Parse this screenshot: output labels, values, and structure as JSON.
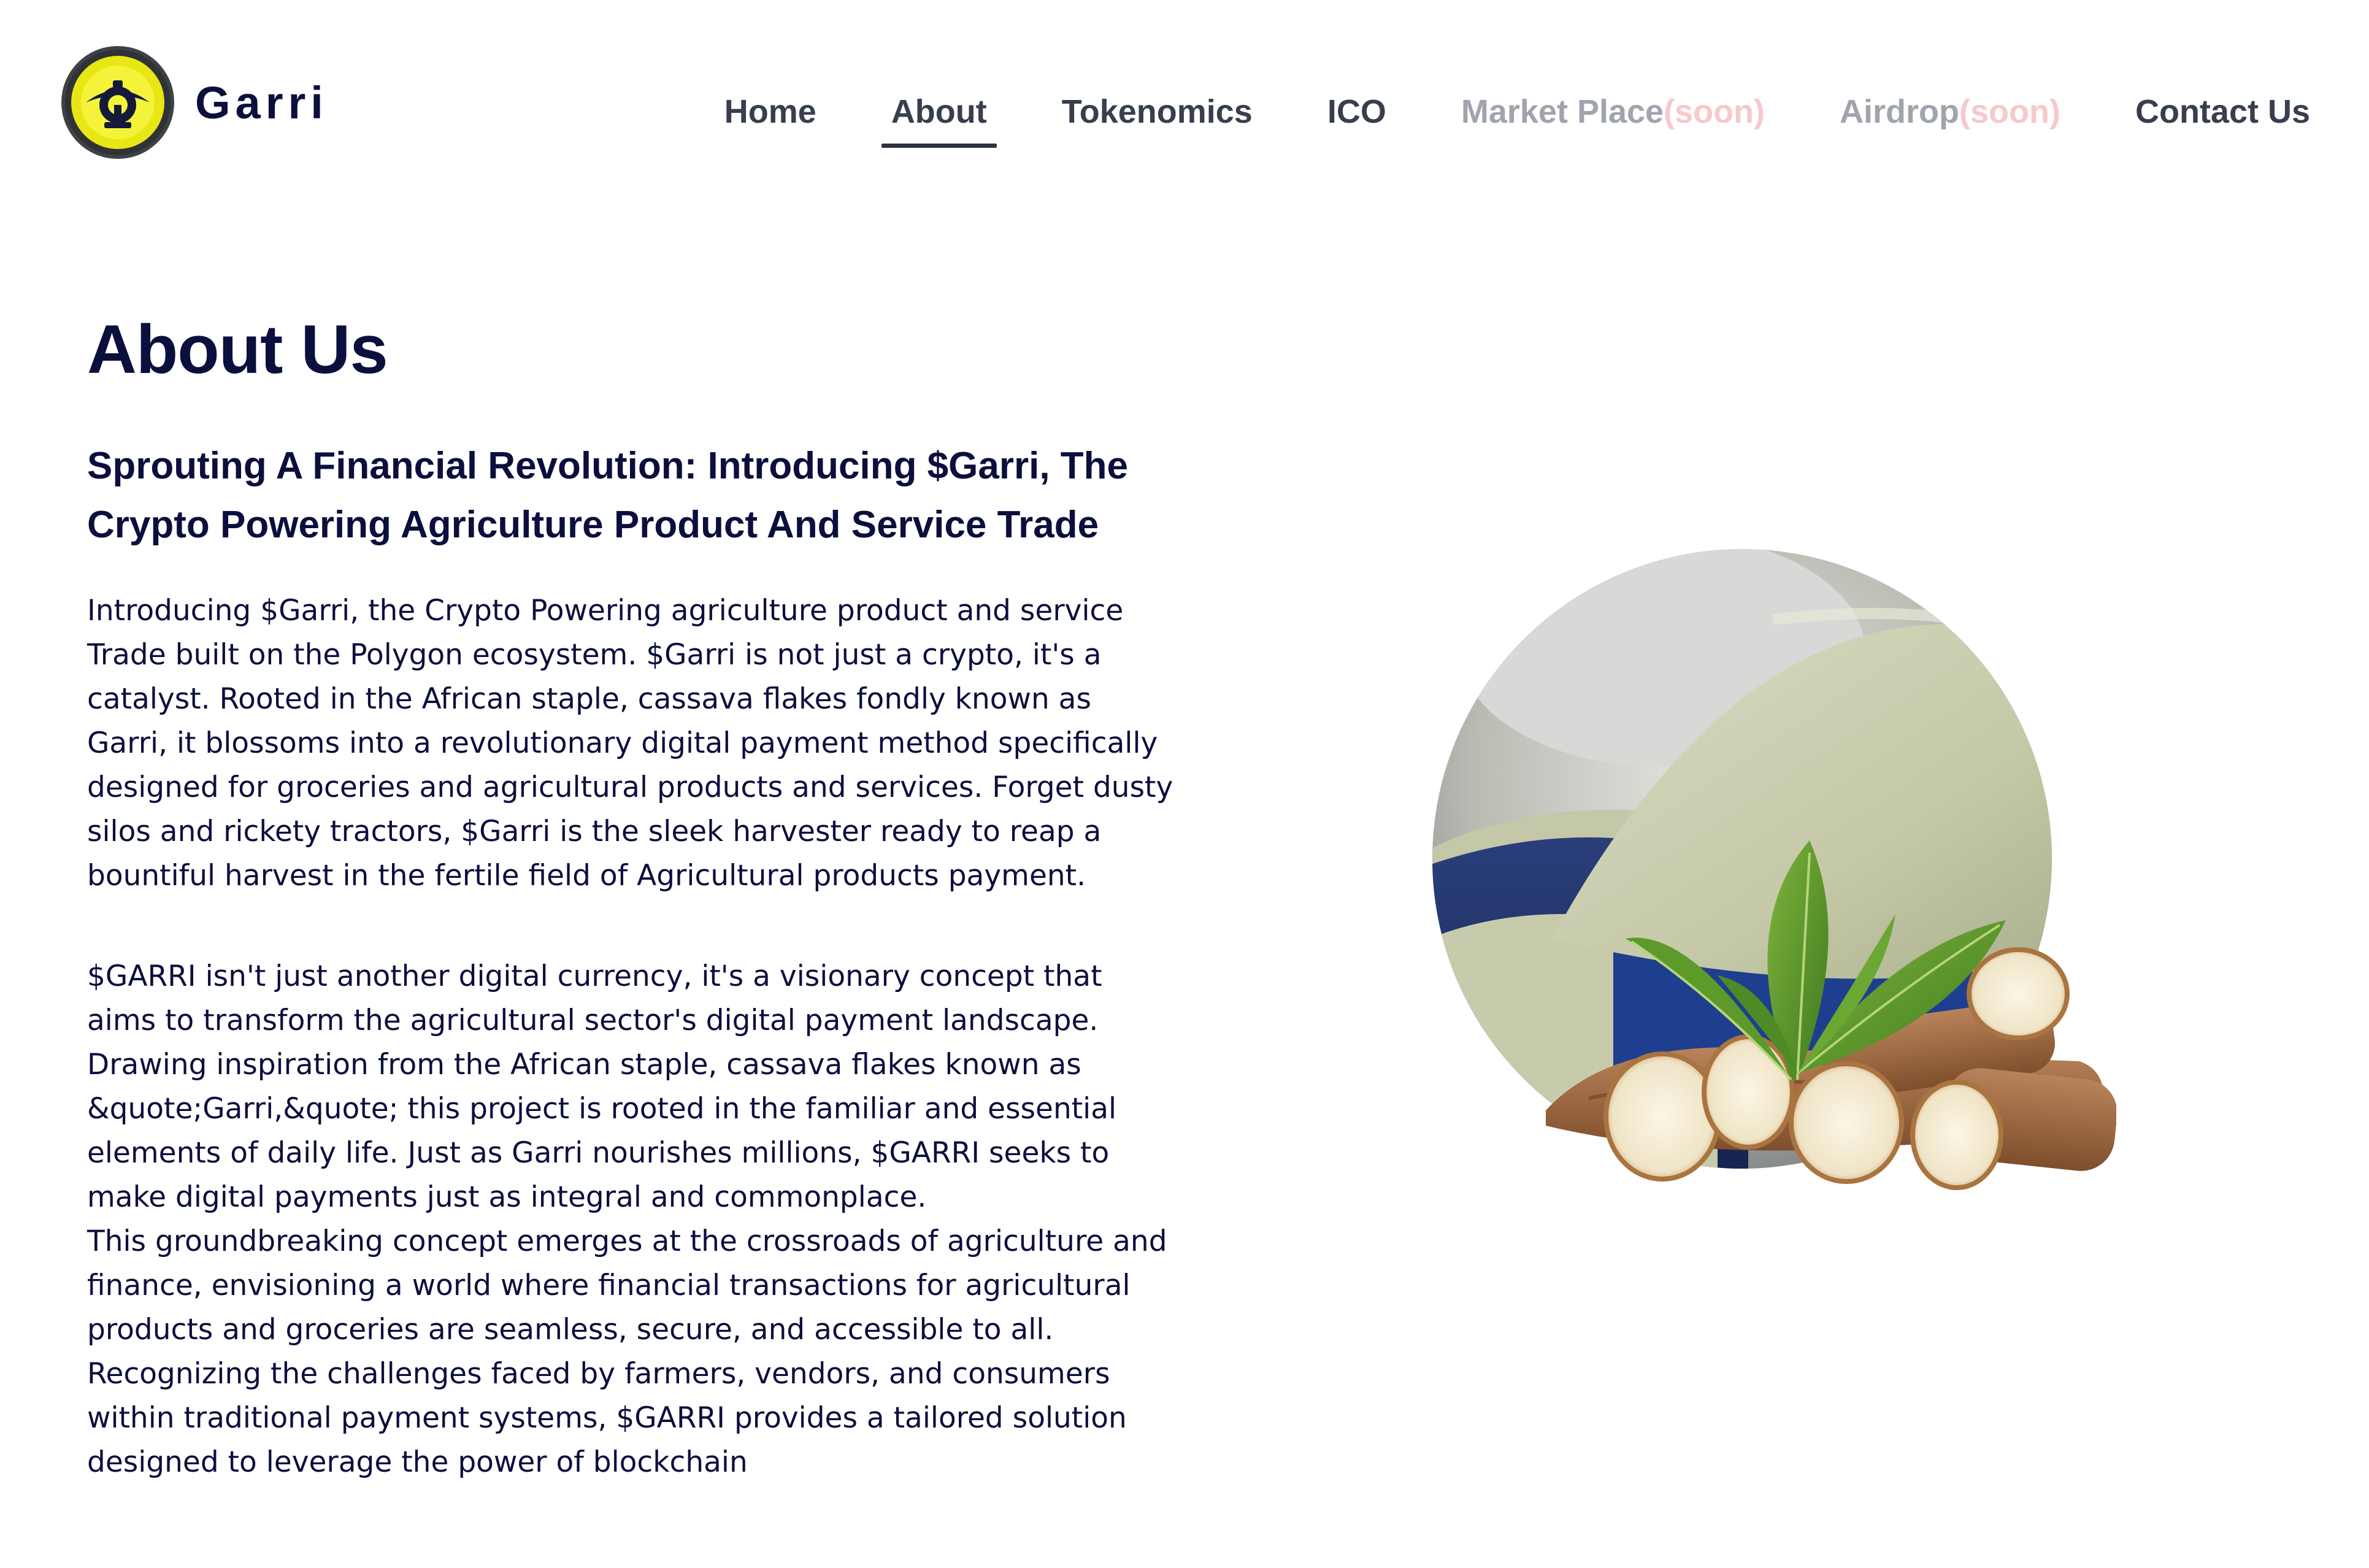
{
  "header": {
    "brand_name": "Garri",
    "logo_icon": "garri-coin-logo",
    "nav": [
      {
        "label": "Home",
        "suffix": "",
        "active": false,
        "muted": false
      },
      {
        "label": "About",
        "suffix": "",
        "active": true,
        "muted": false
      },
      {
        "label": "Tokenomics",
        "suffix": "",
        "active": false,
        "muted": false
      },
      {
        "label": "ICO",
        "suffix": "",
        "active": false,
        "muted": false
      },
      {
        "label": "Market Place",
        "suffix": "(soon)",
        "active": false,
        "muted": true
      },
      {
        "label": "Airdrop",
        "suffix": "(soon)",
        "active": false,
        "muted": true
      },
      {
        "label": "Contact Us",
        "suffix": "",
        "active": false,
        "muted": false
      }
    ]
  },
  "about": {
    "title": "About Us",
    "subtitle": "Sprouting A Financial Revolution: Introducing $Garri, The Crypto Powering Agriculture Product And Service Trade",
    "paragraph1": "Introducing $Garri, the Crypto Powering agriculture product and service Trade built on the Polygon ecosystem. $Garri is not just a crypto, it's a catalyst. Rooted in the African staple, cassava flakes fondly known as Garri, it blossoms into a revolutionary digital payment method specifically designed for groceries and agricultural products and services. Forget dusty silos and rickety tractors, $Garri is the sleek harvester ready to reap a bountiful harvest in the fertile field of Agricultural products payment.",
    "paragraph2_lines": [
      "$GARRI isn't just another digital currency, it's a visionary concept that aims to transform the agricultural sector's digital payment landscape. Drawing inspiration from the African staple, cassava flakes known as &quote;Garri,&quote; this project is rooted in the familiar and essential elements of daily life. Just as Garri nourishes millions, $GARRI seeks to make digital payments just as integral and commonplace.",
      "This groundbreaking concept emerges at the crossroads of agriculture and finance, envisioning a world where financial transactions for agricultural products and groceries are seamless, secure, and accessible to all.",
      "Recognizing the challenges faced by farmers, vendors, and consumers within traditional payment systems, $GARRI provides a tailored solution designed to leverage the power of blockchain"
    ]
  },
  "image": {
    "icon": "garri-cassava-image"
  },
  "colors": {
    "text_dark": "#0b0f3d",
    "nav_text": "#373e4d",
    "nav_muted": "#a0a4ad",
    "soon_pink": "#f6c9cb",
    "logo_yellow": "#f2f01a"
  }
}
